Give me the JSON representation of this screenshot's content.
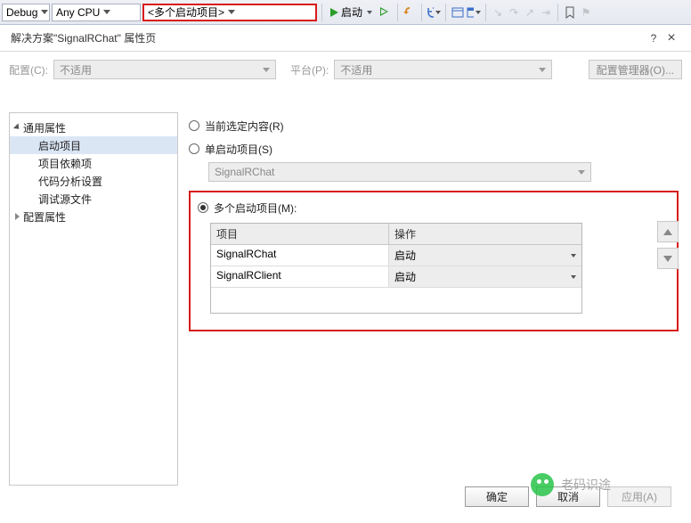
{
  "toolbar": {
    "config": "Debug",
    "platform": "Any CPU",
    "startup": "<多个启动项目>",
    "start_label": "启动"
  },
  "dialog": {
    "title": "解决方案\"SignalRChat\" 属性页",
    "help_icon": "?",
    "close_icon": "×"
  },
  "config_row": {
    "config_label": "配置(C):",
    "config_value": "不适用",
    "platform_label": "平台(P):",
    "platform_value": "不适用",
    "manager_btn": "配置管理器(O)..."
  },
  "tree": {
    "common_label": "通用属性",
    "items": [
      "启动项目",
      "项目依赖项",
      "代码分析设置",
      "调试源文件"
    ],
    "config_label": "配置属性"
  },
  "radios": {
    "current": "当前选定内容(R)",
    "single": "单启动项目(S)",
    "single_value": "SignalRChat",
    "multi": "多个启动项目(M):"
  },
  "grid": {
    "col_project": "项目",
    "col_action": "操作",
    "rows": [
      {
        "project": "SignalRChat",
        "action": "启动"
      },
      {
        "project": "SignalRClient",
        "action": "启动"
      }
    ]
  },
  "buttons": {
    "ok": "确定",
    "cancel": "取消",
    "apply": "应用(A)"
  },
  "watermark": "老码识途"
}
